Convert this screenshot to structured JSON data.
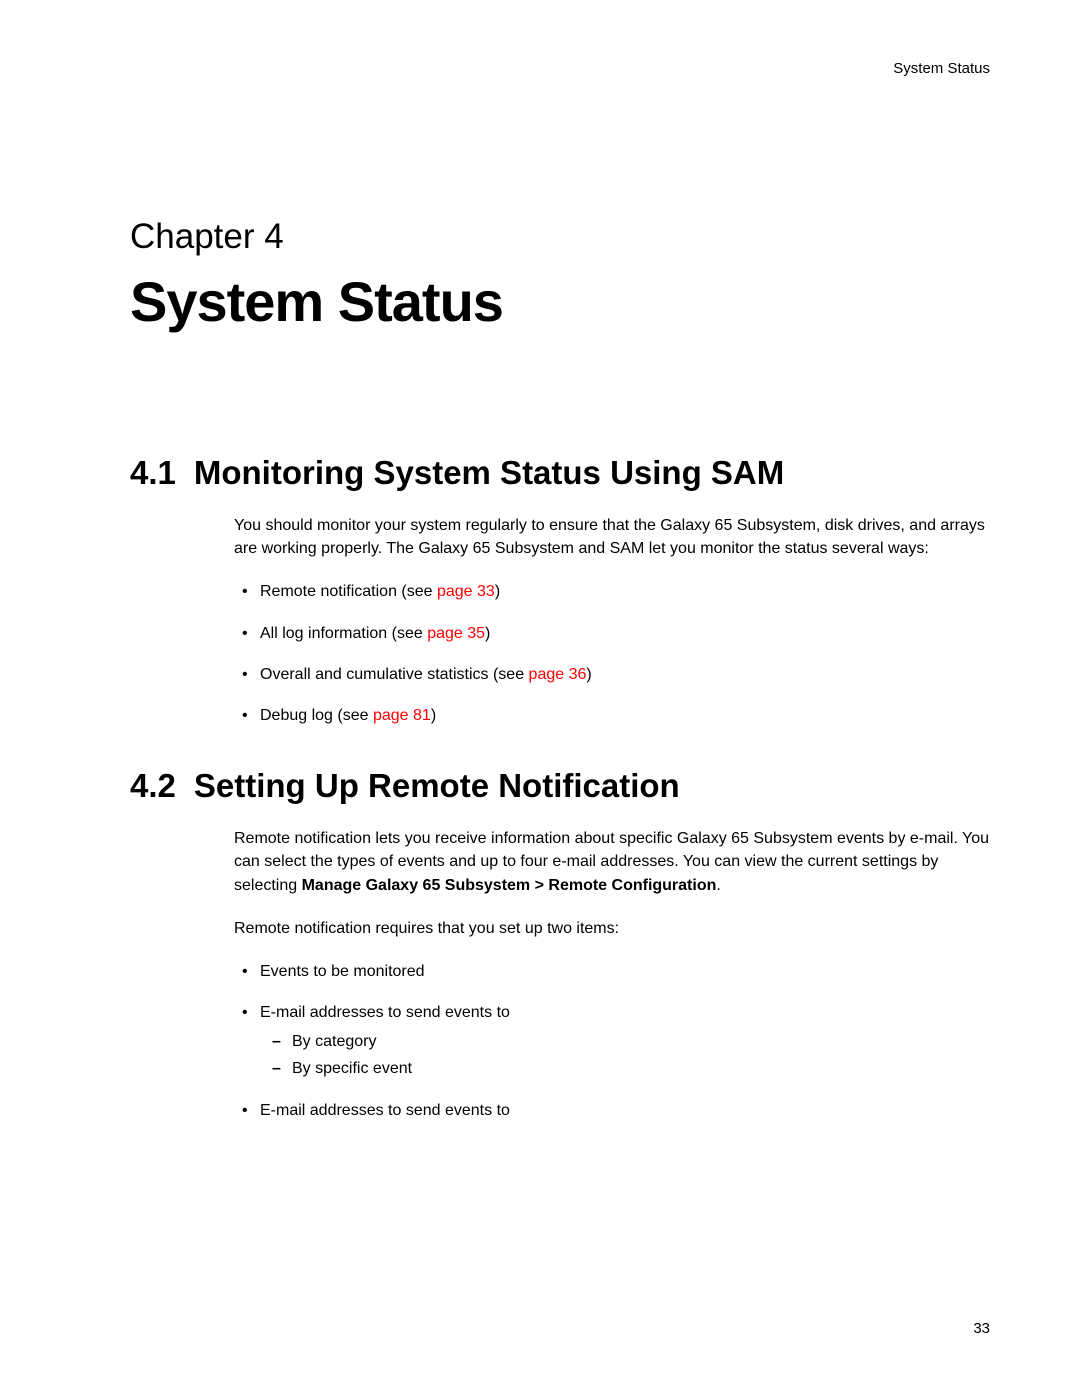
{
  "header": {
    "running_title": "System Status"
  },
  "chapter": {
    "label": "Chapter 4",
    "title": "System Status"
  },
  "sections": [
    {
      "number": "4.1",
      "title": "Monitoring System Status Using SAM",
      "intro": "You should monitor your system regularly to ensure that the Galaxy 65 Subsystem, disk drives, and arrays are working properly. The Galaxy 65 Subsystem and SAM let you monitor the status several ways:",
      "bullets": [
        {
          "text": "Remote notification (see ",
          "link": "page 33",
          "suffix": ")"
        },
        {
          "text": "All log information (see ",
          "link": "page 35",
          "suffix": ")"
        },
        {
          "text": "Overall and cumulative statistics (see ",
          "link": "page 36",
          "suffix": ")"
        },
        {
          "text": "Debug log (see ",
          "link": "page 81",
          "suffix": ")"
        }
      ]
    },
    {
      "number": "4.2",
      "title": "Setting Up Remote Notification",
      "intro_parts": {
        "before": "Remote notification lets you receive information about specific Galaxy 65 Subsystem events by e-mail. You can select the types of events and up to four e-mail addresses. You can view the current settings by selecting ",
        "bold": "Manage Galaxy 65 Subsystem > Remote Configuration",
        "after": "."
      },
      "para2": "Remote notification requires that you set up two items:",
      "bullets2": [
        {
          "text": "Events to be monitored"
        },
        {
          "text": "E-mail addresses to send events to",
          "sub": [
            "By category",
            "By specific event"
          ]
        },
        {
          "text": "E-mail addresses to send events to"
        }
      ]
    }
  ],
  "footer": {
    "page_number": "33"
  }
}
